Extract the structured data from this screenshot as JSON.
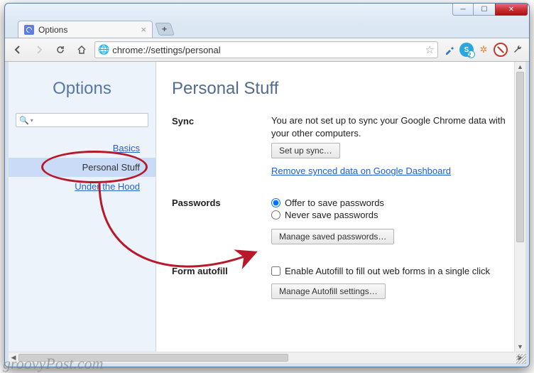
{
  "window": {
    "tab_title": "Options",
    "url": "chrome://settings/personal"
  },
  "sidebar": {
    "title": "Options",
    "items": [
      {
        "label": "Basics",
        "active": false
      },
      {
        "label": "Personal Stuff",
        "active": true
      },
      {
        "label": "Under the Hood",
        "active": false
      }
    ]
  },
  "page": {
    "heading": "Personal Stuff"
  },
  "sync": {
    "label": "Sync",
    "status_text": "You are not set up to sync your Google Chrome data with your other computers.",
    "setup_button": "Set up sync…",
    "remove_link": "Remove synced data on Google Dashboard"
  },
  "passwords": {
    "label": "Passwords",
    "option_offer": "Offer to save passwords",
    "option_never": "Never save passwords",
    "selected": "offer",
    "manage_button": "Manage saved passwords…"
  },
  "autofill": {
    "label": "Form autofill",
    "checkbox_label": "Enable Autofill to fill out web forms in a single click",
    "checked": false,
    "manage_button": "Manage Autofill settings…"
  },
  "watermark": "groovyPost.com",
  "ext_skype_badge": "2"
}
